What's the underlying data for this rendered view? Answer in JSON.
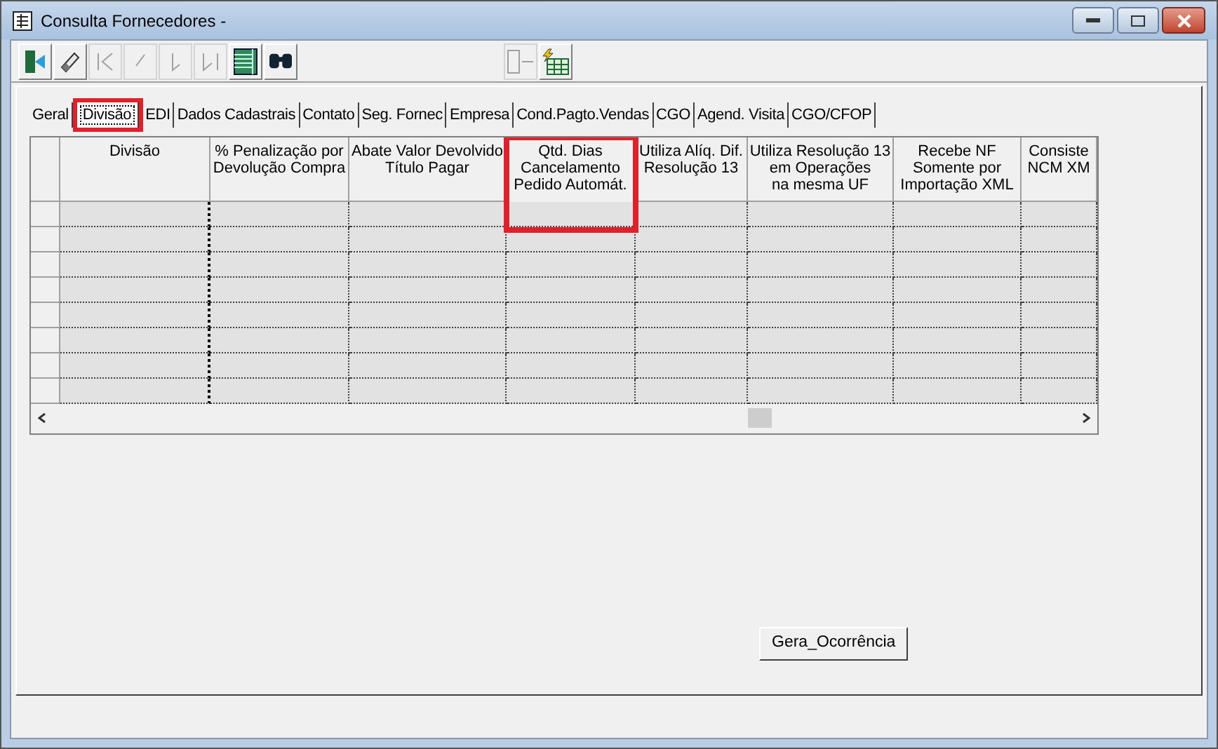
{
  "window": {
    "title": "Consulta Fornecedores -"
  },
  "toolbar": {
    "left": [
      {
        "kind": "exit",
        "disabled": false
      },
      {
        "kind": "eraser",
        "disabled": false
      },
      {
        "kind": "first",
        "disabled": true
      },
      {
        "kind": "prev",
        "disabled": true
      },
      {
        "kind": "next",
        "disabled": true
      },
      {
        "kind": "last",
        "disabled": true
      },
      {
        "kind": "grid",
        "disabled": false
      },
      {
        "kind": "binoculars",
        "disabled": false
      }
    ],
    "right": [
      {
        "kind": "layout",
        "disabled": true
      },
      {
        "kind": "grid-flash",
        "disabled": false
      }
    ]
  },
  "tabs": [
    {
      "label": "Geral",
      "selected": false,
      "highlighted": false
    },
    {
      "label": "Divisão",
      "selected": true,
      "highlighted": true
    },
    {
      "label": "EDI",
      "selected": false,
      "highlighted": false
    },
    {
      "label": "Dados Cadastrais",
      "selected": false,
      "highlighted": false
    },
    {
      "label": "Contato",
      "selected": false,
      "highlighted": false
    },
    {
      "label": "Seg. Fornec",
      "selected": false,
      "highlighted": false
    },
    {
      "label": "Empresa",
      "selected": false,
      "highlighted": false
    },
    {
      "label": "Cond.Pagto.Vendas",
      "selected": false,
      "highlighted": false
    },
    {
      "label": "CGO",
      "selected": false,
      "highlighted": false
    },
    {
      "label": "Agend. Visita",
      "selected": false,
      "highlighted": false
    },
    {
      "label": "CGO/CFOP",
      "selected": false,
      "highlighted": false
    }
  ],
  "table": {
    "columns": [
      {
        "label": "Divisão",
        "highlighted": false
      },
      {
        "label": "% Penalização por\nDevolução Compra",
        "highlighted": false
      },
      {
        "label": "Abate Valor Devolvido\nTítulo Pagar",
        "highlighted": false
      },
      {
        "label": "Qtd. Dias\nCancelamento\nPedido Automát.",
        "highlighted": true
      },
      {
        "label": "Utiliza Alíq. Dif.\nResolução 13",
        "highlighted": false
      },
      {
        "label": "Utiliza Resolução 13\nem Operações\nna mesma UF",
        "highlighted": false
      },
      {
        "label": "Recebe NF\nSomente por\nImportação XML",
        "highlighted": false
      },
      {
        "label": "Consiste\nNCM XM",
        "highlighted": false
      }
    ]
  },
  "button": {
    "label": "Gera_Ocorrência"
  }
}
